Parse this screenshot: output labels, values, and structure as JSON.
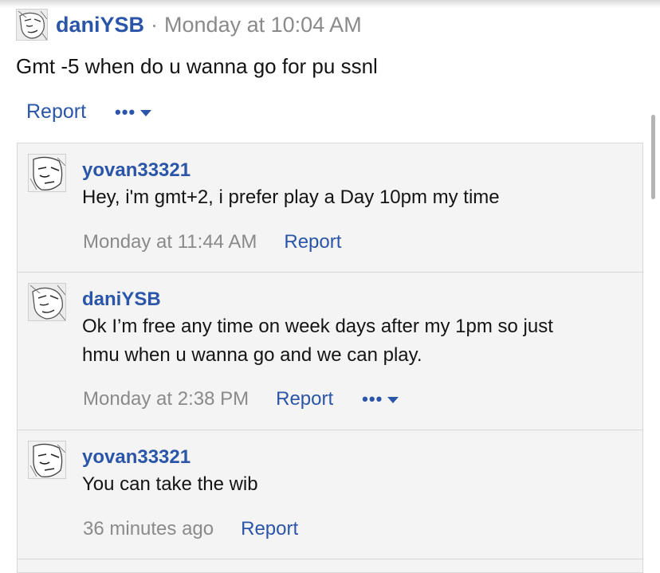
{
  "post": {
    "username": "daniYSB",
    "separator": "·",
    "time": "Monday at 10:04 AM",
    "body": "Gmt -5 when do u wanna go for pu ssnl",
    "report_label": "Report",
    "more_label": "•••"
  },
  "replies": [
    {
      "username": "yovan33321",
      "lines": [
        "Hey, i'm gmt+2, i prefer play a Day 10pm my time"
      ],
      "time": "Monday at 11:44 AM",
      "report_label": "Report"
    },
    {
      "username": "daniYSB",
      "lines": [
        "Ok I’m free any time on week days after my 1pm so just",
        "hmu when u wanna go and we can play."
      ],
      "time": "Monday at 2:38 PM",
      "report_label": "Report",
      "more_label": "•••"
    },
    {
      "username": "yovan33321",
      "lines": [
        "You can take the wib"
      ],
      "time": "36 minutes ago",
      "report_label": "Report"
    }
  ],
  "icons": {
    "more_caret": "caret-down-icon",
    "avatar": "manga-avatar-image"
  },
  "colors": {
    "link": "#2a55a8",
    "muted": "#8a8a8a",
    "comment_bg": "#f4f4f4"
  }
}
